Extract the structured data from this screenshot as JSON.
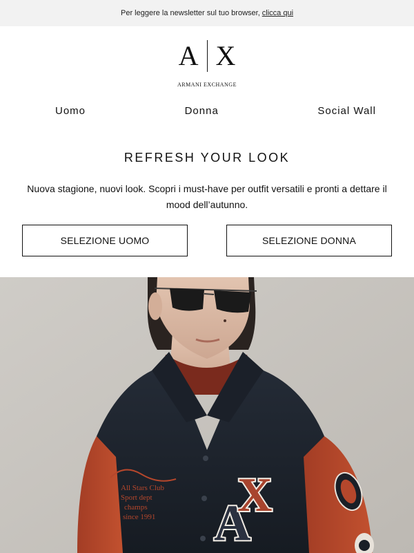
{
  "preheader": {
    "text": "Per leggere la newsletter sul tuo browser,",
    "link_label": "clicca qui"
  },
  "brand": {
    "logo_left": "A",
    "logo_right": "X",
    "wordmark": "ARMANI EXCHANGE"
  },
  "nav": {
    "items": [
      {
        "label": "Uomo"
      },
      {
        "label": "Donna"
      },
      {
        "label": "Social Wall"
      }
    ]
  },
  "hero_section": {
    "title": "REFRESH YOUR LOOK",
    "description": "Nuova stagione, nuovi look. Scopri i must-have per outfit versatili e pronti a dettare il mood dell’autunno."
  },
  "buttons": {
    "men_label": "SELEZIONE UOMO",
    "women_label": "SELEZIONE DONNA"
  },
  "hero_image": {
    "jacket_patch_letters": "AX",
    "embroidery_lines": [
      "All Stars Club",
      "Sport dept",
      "champs",
      "since 1991"
    ],
    "colors": {
      "background": "#c9c6c1",
      "jacket_body": "#1e2530",
      "sleeves": "#b5472c",
      "skin": "#d9b9a4"
    }
  }
}
